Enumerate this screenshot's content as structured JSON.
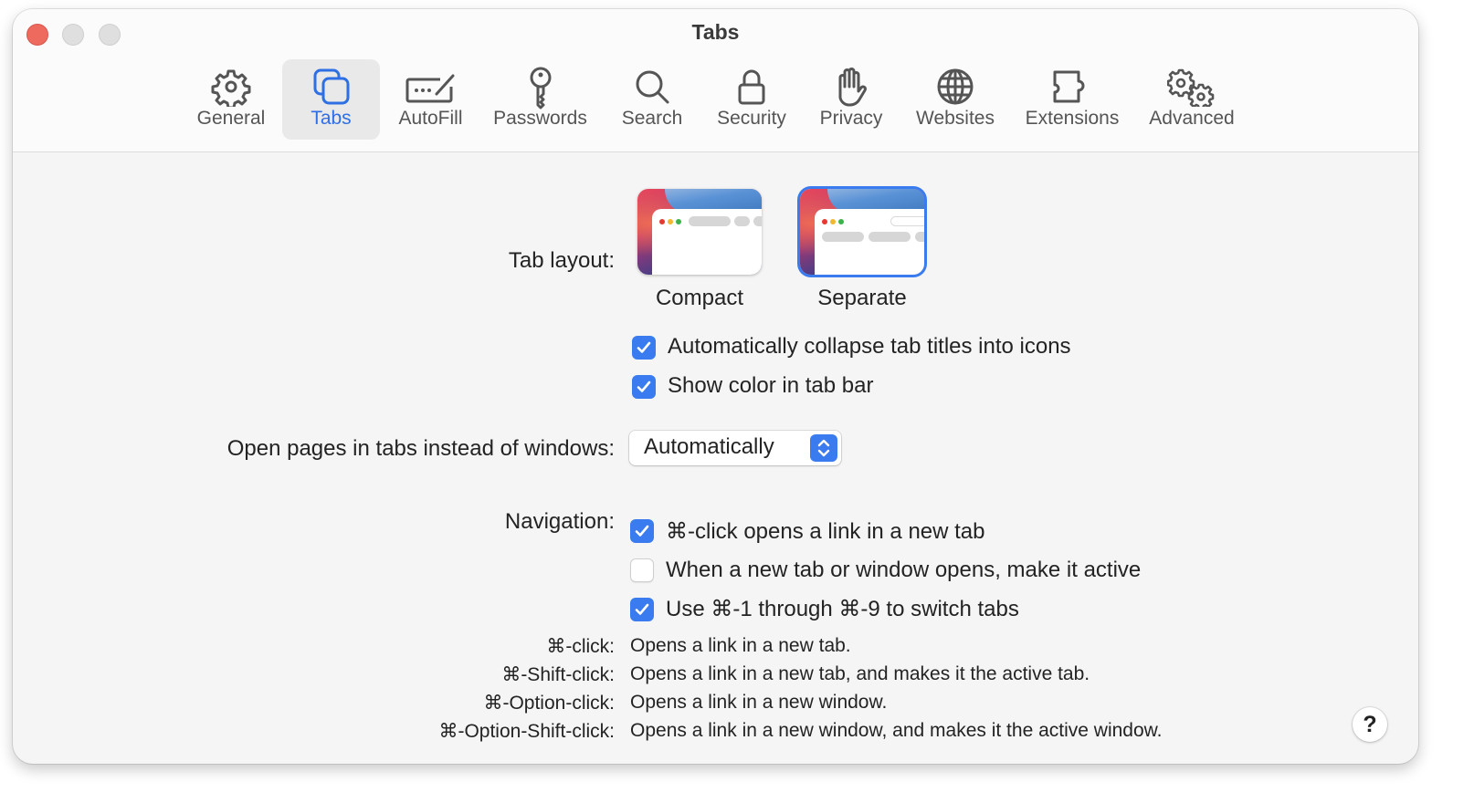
{
  "window": {
    "title": "Tabs"
  },
  "toolbar": {
    "items": [
      {
        "label": "General",
        "icon": "gear-icon",
        "active": false
      },
      {
        "label": "Tabs",
        "icon": "tabs-icon",
        "active": true
      },
      {
        "label": "AutoFill",
        "icon": "autofill-icon",
        "active": false
      },
      {
        "label": "Passwords",
        "icon": "key-icon",
        "active": false
      },
      {
        "label": "Search",
        "icon": "search-icon",
        "active": false
      },
      {
        "label": "Security",
        "icon": "lock-icon",
        "active": false
      },
      {
        "label": "Privacy",
        "icon": "hand-icon",
        "active": false
      },
      {
        "label": "Websites",
        "icon": "globe-icon",
        "active": false
      },
      {
        "label": "Extensions",
        "icon": "puzzle-icon",
        "active": false
      },
      {
        "label": "Advanced",
        "icon": "gears-icon",
        "active": false
      }
    ]
  },
  "tab_layout": {
    "label": "Tab layout:",
    "options": [
      {
        "label": "Compact",
        "selected": false
      },
      {
        "label": "Separate",
        "selected": true
      }
    ],
    "checkboxes": [
      {
        "label": "Automatically collapse tab titles into icons",
        "checked": true
      },
      {
        "label": "Show color in tab bar",
        "checked": true
      }
    ]
  },
  "open_pages": {
    "label": "Open pages in tabs instead of windows:",
    "value": "Automatically"
  },
  "navigation": {
    "label": "Navigation:",
    "checkboxes": [
      {
        "label": "⌘-click opens a link in a new tab",
        "checked": true
      },
      {
        "label": "When a new tab or window opens, make it active",
        "checked": false
      },
      {
        "label": "Use ⌘-1 through ⌘-9 to switch tabs",
        "checked": true
      }
    ]
  },
  "shortcuts": [
    {
      "key": "⌘-click:",
      "desc": "Opens a link in a new tab."
    },
    {
      "key": "⌘-Shift-click:",
      "desc": "Opens a link in a new tab, and makes it the active tab."
    },
    {
      "key": "⌘-Option-click:",
      "desc": "Opens a link in a new window."
    },
    {
      "key": "⌘-Option-Shift-click:",
      "desc": "Opens a link in a new window, and makes it the active window."
    }
  ],
  "help": {
    "label": "?"
  },
  "colors": {
    "accent": "#3a7bf0",
    "close": "#ee6a5e",
    "active_tab_text": "#2f6fe4"
  }
}
